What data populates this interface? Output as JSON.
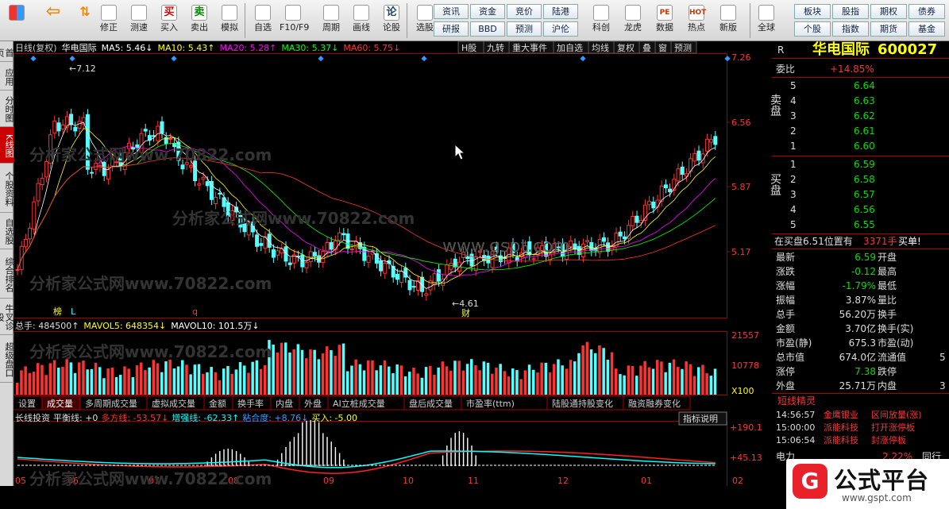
{
  "toolbar": {
    "left_buttons": [
      {
        "label": "修正",
        "icon": "edit-icon"
      },
      {
        "label": "测速",
        "icon": "clock-icon"
      },
      {
        "label": "买入",
        "icon": "buy-icon",
        "glyph": "买"
      },
      {
        "label": "卖出",
        "icon": "sell-icon",
        "glyph": "卖"
      },
      {
        "label": "模拟",
        "icon": "hammer-icon"
      },
      {
        "label": "自选",
        "icon": "folder-icon"
      },
      {
        "label": "F10/F9",
        "icon": "f10-icon"
      },
      {
        "label": "周期",
        "icon": "cycle-icon"
      },
      {
        "label": "画线",
        "icon": "pencil-icon"
      },
      {
        "label": "论股",
        "icon": "forum-icon",
        "glyph": "论"
      },
      {
        "label": "选股",
        "icon": "stock-picker-icon"
      }
    ],
    "grid": [
      [
        "资讯",
        "资金",
        "竞价",
        "陆港"
      ],
      [
        "研报",
        "BBD",
        "预测",
        "沪伦"
      ]
    ],
    "right_buttons": [
      {
        "label": "科创",
        "icon": "star-market-icon"
      },
      {
        "label": "龙虎",
        "icon": "dragon-tiger-icon"
      },
      {
        "label": "数据",
        "icon": "data-icon",
        "glyph": "PE"
      },
      {
        "label": "热点",
        "icon": "hot-icon",
        "glyph": "HOT"
      },
      {
        "label": "新版",
        "icon": "new-version-icon"
      },
      {
        "label": "全球",
        "icon": "globe-icon"
      }
    ],
    "grid2": [
      [
        "板块",
        "股指",
        "期权",
        "债券"
      ],
      [
        "个股",
        "指数",
        "期货",
        "基金"
      ]
    ]
  },
  "left_tabs": [
    "首页",
    "应用",
    "分时图",
    "K线图",
    "个股资料",
    "自选股",
    "综合排名",
    "牛叉诊股",
    "超级盘口"
  ],
  "chart": {
    "header": {
      "period": "日线(复权)",
      "name": "华电国际",
      "ma": [
        {
          "label": "MA5: 5.46↓",
          "color": "#ffffff"
        },
        {
          "label": "MA10: 5.43↑",
          "color": "#ffff00"
        },
        {
          "label": "MA20: 5.28↑",
          "color": "#ff00ff"
        },
        {
          "label": "MA30: 5.37↓",
          "color": "#00ff00"
        },
        {
          "label": "MA60: 5.75↓",
          "color": "#ff3333"
        }
      ]
    },
    "tools": [
      "H股",
      "九转",
      "重大事件",
      "加自选",
      "均线",
      "复权",
      "叠",
      "窗",
      "预测"
    ],
    "price_ticks": [
      "7.26",
      "6.56",
      "5.87",
      "5.17"
    ],
    "volume_ticks": [
      "21557",
      "10778",
      "X100"
    ],
    "indicator_ticks": [
      "+190.1",
      "+45.13"
    ],
    "high_label": "7.12",
    "low_label": "4.61",
    "markers": [
      "榜",
      "L",
      "q",
      "财"
    ],
    "volume_header": {
      "total": "总手: 484500↑",
      "mavol5": "MAVOL5: 648354↓",
      "mavol10": "MAVOL10: 101.5万↓"
    },
    "sub_tabs": [
      "设置",
      "成交量",
      "多周期成交量",
      "虚拟成交量",
      "金额",
      "换手率",
      "内盘",
      "外盘",
      "AI立桩成交量",
      "盘后成交量",
      "市盈率(ttm)",
      "陆股通持股变化",
      "融资融券变化"
    ],
    "active_sub_tab": "成交量",
    "indicator_header": {
      "name": "长线投资",
      "balance": "平衡线: +0",
      "bull": "多方线: -53.57↓",
      "strong": "增强线: -62.33↑",
      "cohesion": "粘合度: +8.76↓",
      "buy": "买入: -5.00"
    },
    "indicator_button": "指标说明",
    "months": [
      "05",
      "06",
      "07",
      "08",
      "09",
      "10",
      "11",
      "12",
      "01",
      "02"
    ],
    "watermarks": [
      "分析家公式网www.70822.com",
      "www.gspt.com"
    ]
  },
  "quote": {
    "title": "华电国际",
    "code": "600027",
    "flag": "R",
    "ratio_label": "委比",
    "ratio": "+14.85%",
    "sell_label": "卖盘",
    "buy_label": "买盘",
    "sells": [
      {
        "n": "5",
        "p": "6.64"
      },
      {
        "n": "4",
        "p": "6.63"
      },
      {
        "n": "3",
        "p": "6.62"
      },
      {
        "n": "2",
        "p": "6.61"
      },
      {
        "n": "1",
        "p": "6.60"
      }
    ],
    "buys": [
      {
        "n": "1",
        "p": "6.59"
      },
      {
        "n": "2",
        "p": "6.58"
      },
      {
        "n": "3",
        "p": "6.57"
      },
      {
        "n": "4",
        "p": "6.56"
      },
      {
        "n": "5",
        "p": "6.55"
      }
    ],
    "notice": "在买盘6.51位置有",
    "notice_vol": "3371手",
    "notice_tag": "买单!",
    "stats": [
      [
        "最新",
        "6.59",
        "开盘",
        ""
      ],
      [
        "涨跌",
        "-0.12",
        "最高",
        ""
      ],
      [
        "涨幅",
        "-1.79%",
        "最低",
        ""
      ],
      [
        "振幅",
        "3.87%",
        "量比",
        ""
      ],
      [
        "总手",
        "56.20万",
        "换手",
        ""
      ],
      [
        "金额",
        "3.70亿",
        "换手(实)",
        ""
      ],
      [
        "市盈(静)",
        "675.3",
        "市盈(动)",
        ""
      ],
      [
        "总市值",
        "674.0亿",
        "流通值",
        "5"
      ],
      [
        "涨停",
        "7.38",
        "跌停",
        ""
      ],
      [
        "外盘",
        "25.71万",
        "内盘",
        "3"
      ]
    ],
    "elf_title": "短线精灵",
    "elf": [
      {
        "time": "14:56:57",
        "name": "金鹰银业",
        "event": "区间放量(涨)"
      },
      {
        "time": "15:00:00",
        "name": "派能科技",
        "event": "打开涨停板"
      },
      {
        "time": "15:06:54",
        "name": "派能科技",
        "event": "封涨停板"
      }
    ],
    "bottom": {
      "name": "电力",
      "pct": "2.22%",
      "more": "同行"
    }
  },
  "logo": {
    "text": "公式平台",
    "url_text": "www.gspt.com",
    "badge": "G"
  },
  "colors": {
    "up": "#ff3232",
    "down": "#54ffff",
    "green": "#00e000",
    "yellow": "#ffff00",
    "frame": "#a00000"
  }
}
